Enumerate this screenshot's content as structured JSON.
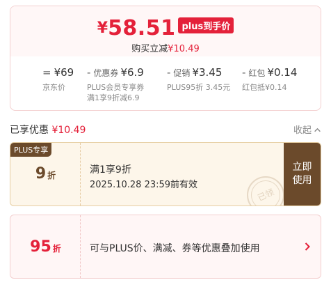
{
  "summary": {
    "currency": "¥",
    "final_price": "58.51",
    "plus_badge": "plus到手价",
    "save_prefix": "购买立减",
    "save_amount": "¥10.49"
  },
  "breakdown": [
    {
      "op": "=",
      "label": "",
      "value": "¥69",
      "sub": [
        "京东价"
      ]
    },
    {
      "op": "-",
      "label": "优惠券",
      "value": "¥6.9",
      "sub": [
        "PLUS会员专享券",
        "满1享9折减6.9"
      ]
    },
    {
      "op": "-",
      "label": "促销",
      "value": "¥3.45",
      "sub": [
        "PLUS95折 3.45元"
      ]
    },
    {
      "op": "-",
      "label": "红包",
      "value": "¥0.14",
      "sub": [
        "红包抵¥0.14"
      ]
    }
  ],
  "applied": {
    "label": "已享优惠",
    "amount": "¥10.49",
    "collapse_label": "收起"
  },
  "plus_coupon": {
    "tag": "PLUS专享",
    "discount_num": "9",
    "discount_unit": "折",
    "title": "满1享9折",
    "expire": "2025.10.28 23:59前有效",
    "stamp_text": "已领",
    "button_line1": "立即",
    "button_line2": "使用"
  },
  "promo_95": {
    "discount_num": "95",
    "discount_unit": "折",
    "description": "可与PLUS价、满减、券等优惠叠加使用"
  },
  "colors": {
    "accent_red": "#e4213a",
    "plus_brown": "#6b4a2b",
    "plus_bg": "#fdf6ea"
  }
}
